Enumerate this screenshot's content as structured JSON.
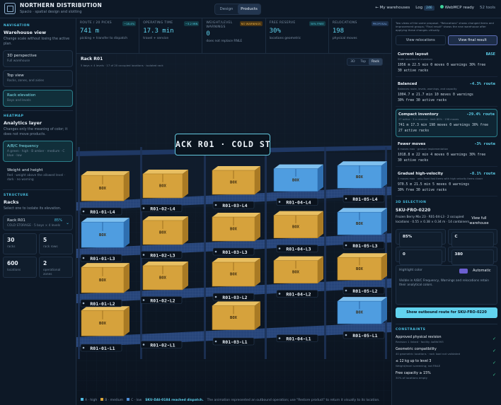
{
  "app": {
    "title": "NORTHERN DISTRIBUTION",
    "subtitle": "Spacio · spatial design and slotting",
    "mode_tabs": [
      "Design",
      "Products"
    ],
    "active_mode": "Products",
    "nav_back": "← My warehouses",
    "log_label": "Log",
    "log_badge": "246",
    "status": "WebMCP ready",
    "tools": "52 tools"
  },
  "sidebar": {
    "navigation": {
      "section": "NAVIGATION",
      "title": "Warehouse view",
      "desc": "Change scale without losing the active plan.",
      "items": [
        {
          "title": "3D perspective",
          "sub": "Full warehouse"
        },
        {
          "title": "Top view",
          "sub": "Racks, zones, and aisles"
        },
        {
          "title": "Rack elevation",
          "sub": "Bays and levels"
        }
      ]
    },
    "heatmap": {
      "section": "HEATMAP",
      "title": "Analytics layer",
      "desc": "Changes only the meaning of color; it does not move products.",
      "items": [
        {
          "title": "A/B/C frequency",
          "sub": "A green · high · B amber · medium · C blue · low"
        },
        {
          "title": "Weight and height",
          "sub": "Red · weight above the allowed level · dark · no warning"
        }
      ]
    },
    "structure": {
      "section": "STRUCTURE",
      "title": "Racks",
      "desc": "Select one to isolate its elevation.",
      "rack": {
        "name": "Rack R01",
        "pct": "85%",
        "sub": "COLD STORAGE · 5 bays × 4 levels"
      },
      "stats": [
        {
          "value": "30",
          "label": "racks"
        },
        {
          "value": "5",
          "label": "rack rows"
        },
        {
          "value": "600",
          "label": "locations"
        },
        {
          "value": "2",
          "label": "operational zones"
        }
      ]
    }
  },
  "kpis": [
    {
      "label": "ROUTE / 20 PICKS",
      "value": "741 m",
      "sub": "picking + transfer to dispatch",
      "pill": "−18.4%",
      "pill_kind": "good"
    },
    {
      "label": "OPERATING TIME",
      "value": "17.3 min",
      "sub": "travel + service",
      "pill": "−3.2 MIN",
      "pill_kind": "good"
    },
    {
      "label": "WEIGHT/LEVEL WARNINGS",
      "value": "0",
      "sub": "does not replace RNLE",
      "pill": "NO WARNINGS",
      "pill_kind": "warn"
    },
    {
      "label": "FREE RESERVE",
      "value": "30%",
      "sub": "locations geometric",
      "pill": "30% FREE",
      "pill_kind": "good"
    },
    {
      "label": "RELOCATIONS",
      "value": "198",
      "sub": "physical moves",
      "pill": "PROPOSAL",
      "pill_kind": "prop"
    }
  ],
  "scene": {
    "title": "Rack R01",
    "subtitle": "5 bays × 4 levels · 17 of 20 occupied locations · isolated rack",
    "view_tabs": [
      "3D",
      "Top",
      "Rack"
    ],
    "active_view": "Rack",
    "banner": "ACK R01 · COLD STORAG",
    "box_label": "BOX",
    "slot_labels": [
      "R01-01-L4",
      "R01-02-L4",
      "R01-03-L4",
      "R01-04-L4",
      "R01-05-L4",
      "R01-01-L3",
      "R01-02-L3",
      "R01-03-L3",
      "R01-04-L3",
      "R01-05-L3",
      "R01-01-L2",
      "R01-02-L2",
      "R01-03-L2",
      "R01-04-L2",
      "R01-05-L2",
      "R01-01-L1",
      "R01-02-L1",
      "R01-03-L1",
      "R01-04-L1",
      "R01-05-L1"
    ],
    "legend": {
      "a": "A · high",
      "b": "B · medium",
      "c": "C · low",
      "highlight": "SKU-DAI-0184 reached dispatch.",
      "message": "The animation represented an outbound operation; use \"Restore product\" to return it visually to its location."
    }
  },
  "right": {
    "note": "Two views of the same proposal. \"Relocations\" shows changed items and improvement groups; \"Final result\" shows the new warehouse after applying these changes virtually.",
    "tabs": [
      "View relocations",
      "View final result"
    ],
    "active_tab": "View final result",
    "scenarios": [
      {
        "name": "Current layout",
        "delta": "BASE",
        "desc": "State recorded in inventory",
        "m1": "1056 m  22.5 min  0 moves  0 warnings  30% free",
        "m2": "30 active racks"
      },
      {
        "name": "Balanced",
        "delta": "-4.3% route",
        "desc": "Balances route, levels, warnings, and capacity",
        "m1": "1004.7 m  21.7 min  10 moves  0 warnings",
        "m2": "30% free  30 active racks"
      },
      {
        "name": "Compact inventory",
        "delta": "-29.4% route",
        "desc": "27 active · 3 in reserve · limit 85% · 198 moves",
        "m1": "741 m  17.3 min  198 moves  0 warnings  30% free",
        "m2": "27 active racks"
      },
      {
        "name": "Fewer moves",
        "delta": "-3% route",
        "desc": "8 moves max · gradual implementation",
        "m1": "1018.8 m  22 min  4 moves  0 warnings  30% free",
        "m2": "30 active racks"
      },
      {
        "name": "Gradual high-velocity",
        "delta": "-8.1% route",
        "desc": "5 moves max · only fixed fast items with high velocity items closer",
        "m1": "970.5 m  21.5 min  5 moves  0 warnings",
        "m2": "30% free  30 active racks"
      }
    ],
    "active_scenario": 2,
    "selection": {
      "section": "3D SELECTION",
      "sku": "SKU-FRO-0220",
      "desc": "Frozen Berry Mix 23 · R01-04-L3 · 2 occupied locations · 0.55 × 0.38 × 0.34 m · 14 containers",
      "view_link": "View full warehouse",
      "stats": [
        {
          "value": "85%",
          "label": "occupancy"
        },
        {
          "value": "C",
          "label": "Fast-moving SKUs"
        },
        {
          "value": "0",
          "label": "warnings"
        },
        {
          "value": "380",
          "label": "picks / 30 days"
        }
      ],
      "highlight_label": "Highlight color",
      "highlight_value": "Automatic",
      "highlight_desc": "Visible in A/B/C Frequency, Warnings and relocations retain their analytical colors.",
      "cta": "Show outbound route for SKU-FRO-0220"
    },
    "constraints": {
      "section": "CONSTRAINTS",
      "items": [
        {
          "name": "Approved physical revision",
          "desc": "Revision 1 linked · facility 4a8fd393"
        },
        {
          "name": "Geometric compatibility",
          "desc": "40 geometric locations · rack load not validated"
        },
        {
          "name": "≤ 12 kg up to level 3",
          "desc": "Weight/level screening; not RNLE"
        },
        {
          "name": "Free capacity ≥ 15%",
          "desc": "30% of locations empty"
        }
      ]
    }
  },
  "colors": {
    "accent": "#5fd3ee",
    "a": "#3ed19a",
    "b": "#f0b545",
    "c": "#4f8fd8"
  }
}
